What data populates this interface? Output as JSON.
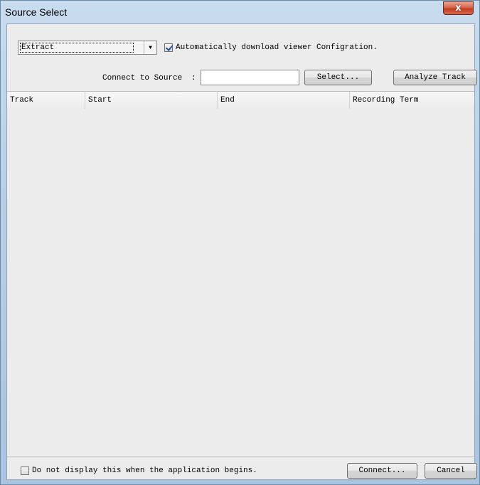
{
  "window": {
    "title": "Source Select",
    "close_glyph": "x"
  },
  "source_mode": {
    "selected": "Extract"
  },
  "auto_download": {
    "checked": true,
    "label": "Automatically download viewer Configration."
  },
  "connect": {
    "label": "Connect to Source",
    "separator": ":",
    "value": "",
    "select_label": "Select...",
    "analyze_label": "Analyze Track"
  },
  "table": {
    "columns": [
      "Track",
      "Start",
      "End",
      "Recording Term"
    ],
    "rows": []
  },
  "footer": {
    "dont_display": {
      "checked": false,
      "label": "Do not display this when the application begins."
    },
    "connect_label": "Connect...",
    "cancel_label": "Cancel"
  },
  "icons": {
    "dropdown_arrow": "chevron-down-icon",
    "close": "close-icon"
  }
}
